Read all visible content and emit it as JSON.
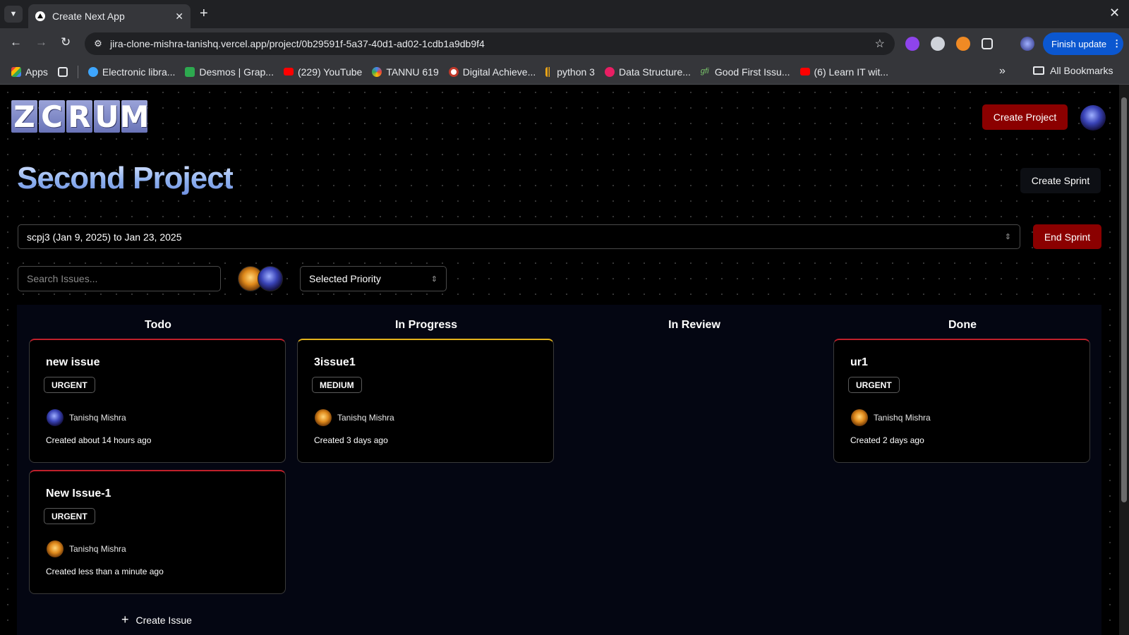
{
  "browser": {
    "tab_title": "Create Next App",
    "url": "jira-clone-mishra-tanishq.vercel.app/project/0b29591f-5a37-40d1-ad02-1cdb1a9db9f4",
    "finish_update": "Finish update",
    "bookmarks": [
      {
        "label": "Apps",
        "icon": "apps-grid-icon"
      },
      {
        "label": "Electronic libra...",
        "icon": "globe-icon"
      },
      {
        "label": "Desmos | Grap...",
        "icon": "desmos-icon"
      },
      {
        "label": "(229) YouTube",
        "icon": "youtube-icon"
      },
      {
        "label": "TANNU 619",
        "icon": "swirl-icon"
      },
      {
        "label": "Digital Achieve...",
        "icon": "badge-icon"
      },
      {
        "label": "python 3",
        "icon": "python-icon"
      },
      {
        "label": "Data Structure...",
        "icon": "ds-icon"
      },
      {
        "label": "Good First Issu...",
        "icon": "gfi-icon"
      },
      {
        "label": "(6) Learn IT wit...",
        "icon": "youtube-icon"
      }
    ],
    "all_bookmarks": "All Bookmarks"
  },
  "app": {
    "logo_letters": [
      "Z",
      "C",
      "R",
      "U",
      "M"
    ],
    "create_project": "Create Project",
    "project_title": "Second Project",
    "create_sprint": "Create Sprint",
    "sprint_selected": "scpj3 (Jan 9, 2025) to Jan 23, 2025",
    "end_sprint": "End Sprint",
    "search_placeholder": "Search Issues...",
    "priority_selected": "Selected Priority",
    "create_issue": "Create Issue"
  },
  "board": {
    "columns": [
      "Todo",
      "In Progress",
      "In Review",
      "Done"
    ],
    "cards": [
      {
        "title": "new issue",
        "priority": "URGENT",
        "assignee": "Tanishq Mishra",
        "created": "Created about 14 hours ago",
        "column": "Todo"
      },
      {
        "title": "New Issue-1",
        "priority": "URGENT",
        "assignee": "Tanishq Mishra",
        "created": "Created less than a minute ago",
        "column": "Todo"
      },
      {
        "title": "3issue1",
        "priority": "MEDIUM",
        "assignee": "Tanishq Mishra",
        "created": "Created 3 days ago",
        "column": "In Progress"
      },
      {
        "title": "ur1",
        "priority": "URGENT",
        "assignee": "Tanishq Mishra",
        "created": "Created 2 days ago",
        "column": "Done"
      }
    ]
  },
  "colors": {
    "accent_red": "#8b0000",
    "urgent_border": "#c0202b",
    "medium_border": "#e3b21c",
    "title_gradient_top": "#dfe8ff",
    "title_gradient_bottom": "#6e8ee0"
  }
}
